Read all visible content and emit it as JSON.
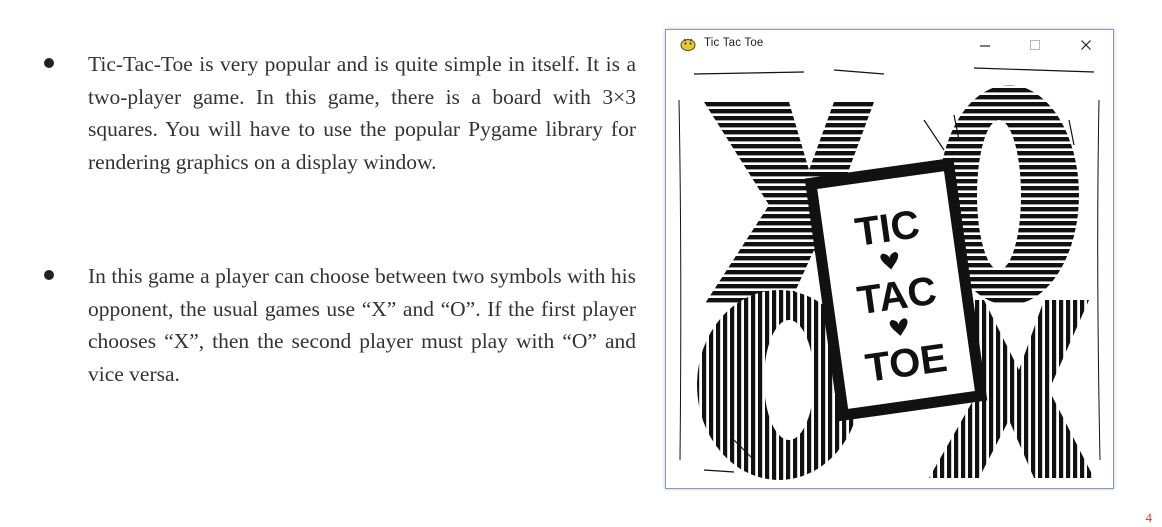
{
  "bullets": [
    {
      "text": "Tic-Tac-Toe is very popular and is quite simple in itself. It is a two-player game. In this game, there is a board with 3×3 squares. You will have to use the popular Pygame library for rendering graphics on a display window."
    },
    {
      "text": "In this game a player can choose between two symbols with his opponent, the usual games use “X” and “O”. If the first player chooses “X”, then the second player must play with “O” and vice versa."
    }
  ],
  "window": {
    "title": "Tic Tac Toe",
    "app_icon": "pygame-snake-icon",
    "controls": [
      "minimize-icon",
      "maximize-icon",
      "close-icon"
    ]
  },
  "artwork": {
    "title_lines": [
      "TIC",
      "TAC",
      "TOE"
    ],
    "big_letters": [
      "X",
      "O",
      "O",
      "X"
    ],
    "separator_icon": "heart-icon"
  },
  "page_number": "4",
  "colors": {
    "window_border": "#7a9cc6",
    "ink": "#111111",
    "page_number": "#d23b2a",
    "body_text": "#333333"
  }
}
